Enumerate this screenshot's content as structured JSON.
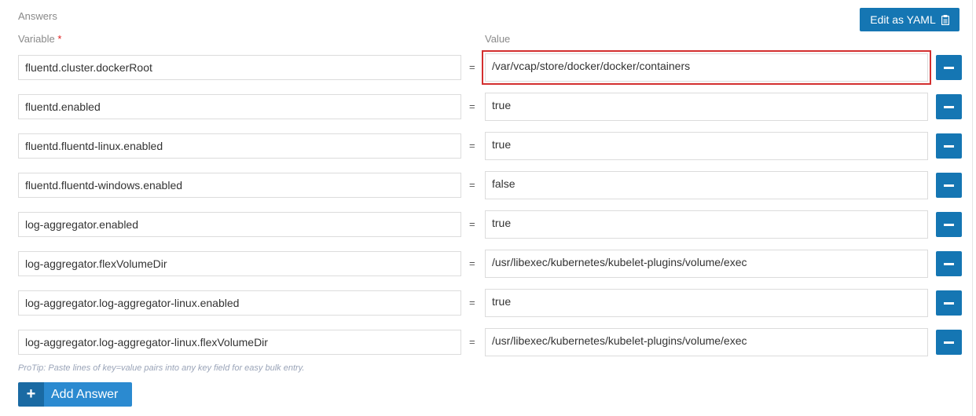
{
  "section": {
    "title": "Answers",
    "edit_yaml_label": "Edit as YAML"
  },
  "columns": {
    "variable_label": "Variable",
    "required_marker": "*",
    "value_label": "Value"
  },
  "equals_sign": "=",
  "rows": [
    {
      "variable": "fluentd.cluster.dockerRoot",
      "value": "/var/vcap/store/docker/docker/containers",
      "highlighted": true
    },
    {
      "variable": "fluentd.enabled",
      "value": "true",
      "highlighted": false
    },
    {
      "variable": "fluentd.fluentd-linux.enabled",
      "value": "true",
      "highlighted": false
    },
    {
      "variable": "fluentd.fluentd-windows.enabled",
      "value": "false",
      "highlighted": false
    },
    {
      "variable": "log-aggregator.enabled",
      "value": "true",
      "highlighted": false
    },
    {
      "variable": "log-aggregator.flexVolumeDir",
      "value": "/usr/libexec/kubernetes/kubelet-plugins/volume/exec",
      "highlighted": false
    },
    {
      "variable": "log-aggregator.log-aggregator-linux.enabled",
      "value": "true",
      "highlighted": false
    },
    {
      "variable": "log-aggregator.log-aggregator-linux.flexVolumeDir",
      "value": "/usr/libexec/kubernetes/kubelet-plugins/volume/exec",
      "highlighted": false
    }
  ],
  "protip": "ProTip: Paste lines of key=value pairs into any key field for easy bulk entry.",
  "add_answer": {
    "icon": "+",
    "label": "Add Answer"
  },
  "colors": {
    "primary": "#1576b3",
    "highlight": "#d32f2f",
    "add_button": "#2b8ad0"
  }
}
